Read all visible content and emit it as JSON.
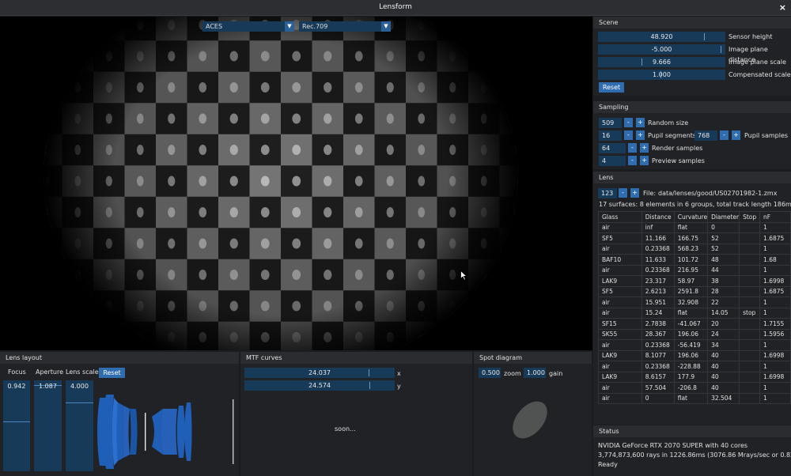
{
  "window": {
    "title": "Lensform",
    "close": "×"
  },
  "viewport": {
    "tonemap_dropdown": "ACES",
    "colorspace_dropdown": "Rec.709",
    "dropdown_arrow": "▼"
  },
  "scene": {
    "title": "Scene",
    "sliders": [
      {
        "value": "48.920",
        "label": "Sensor height",
        "level": 0.85
      },
      {
        "value": "-5.000",
        "label": "Image plane distance",
        "level": 0.98
      },
      {
        "value": "9.666",
        "label": "Image plane scale",
        "level": 0.35
      },
      {
        "value": "1.000",
        "label": "Compensated scale",
        "level": 0.5
      }
    ],
    "reset": "Reset"
  },
  "sampling": {
    "title": "Sampling",
    "rows": [
      {
        "value": "509",
        "label": "Random size"
      },
      {
        "value": "16",
        "label": "Pupil segments"
      },
      {
        "value": "64",
        "label": "Render samples"
      },
      {
        "value": "4",
        "label": "Preview samples"
      }
    ],
    "pupil_samples": {
      "value": "768",
      "label": "Pupil samples"
    },
    "minus": "-",
    "plus": "+"
  },
  "lens": {
    "title": "Lens",
    "index": "123",
    "file_label": "File:",
    "file": "data/lenses/good/US02701982-1.zmx",
    "summary": "17 surfaces: 8 elements in 6 groups, total track length 186mm",
    "columns": [
      "Glass",
      "Distance",
      "Curvature",
      "Diameter",
      "Stop",
      "nF"
    ],
    "rows": [
      [
        "air",
        "inf",
        "flat",
        "0",
        "",
        "1"
      ],
      [
        "SF5",
        "11.166",
        "166.75",
        "52",
        "",
        "1.6875"
      ],
      [
        "air",
        "0.23368",
        "568.23",
        "52",
        "",
        "1"
      ],
      [
        "BAF10",
        "11.633",
        "101.72",
        "48",
        "",
        "1.68"
      ],
      [
        "air",
        "0.23368",
        "216.95",
        "44",
        "",
        "1"
      ],
      [
        "LAK9",
        "23.317",
        "58.97",
        "38",
        "",
        "1.6998"
      ],
      [
        "SF5",
        "2.6213",
        "2591.8",
        "28",
        "",
        "1.6875"
      ],
      [
        "air",
        "15.951",
        "32.908",
        "22",
        "",
        "1"
      ],
      [
        "air",
        "15.24",
        "flat",
        "14.05",
        "stop",
        "1"
      ],
      [
        "SF15",
        "2.7838",
        "-41.067",
        "20",
        "",
        "1.7155"
      ],
      [
        "SK55",
        "28.367",
        "196.06",
        "24",
        "",
        "1.5956"
      ],
      [
        "air",
        "0.23368",
        "-56.419",
        "34",
        "",
        "1"
      ],
      [
        "LAK9",
        "8.1077",
        "196.06",
        "40",
        "",
        "1.6998"
      ],
      [
        "air",
        "0.23368",
        "-228.88",
        "40",
        "",
        "1"
      ],
      [
        "LAK9",
        "8.6157",
        "177.9",
        "40",
        "",
        "1.6998"
      ],
      [
        "air",
        "57.504",
        "-206.8",
        "40",
        "",
        "1"
      ],
      [
        "air",
        "0",
        "flat",
        "32.504",
        "",
        "1"
      ]
    ]
  },
  "status": {
    "title": "Status",
    "gpu": "NVIDIA GeForce RTX 2070 SUPER with 40 cores",
    "rays": "3,774,873,600 rays in 1226.86ms  (3076.86 Mrays/sec or 0.82 fps)",
    "state": "Ready"
  },
  "lens_layout": {
    "title": "Lens layout",
    "focus_label": "Focus",
    "aperture_label": "Aperture",
    "scale_label": "Lens scale",
    "reset": "Reset",
    "focus": "0.942",
    "aperture": "1.087",
    "scale": "4.000",
    "focus_level": 0.55,
    "aperture_level": 0.95,
    "scale_level": 0.76
  },
  "mtf": {
    "title": "MTF curves",
    "x_value": "24.037",
    "x_label": "x",
    "y_value": "24.574",
    "y_label": "y",
    "placeholder": "soon..."
  },
  "spot": {
    "title": "Spot diagram",
    "zoom_value": "0.500",
    "zoom_label": "zoom",
    "gain_value": "1.000",
    "gain_label": "gain"
  },
  "colors": {
    "accent": "#2f6db0",
    "field": "#183a59",
    "panel": "#202225",
    "lens_blue": "#1f5fb8"
  }
}
